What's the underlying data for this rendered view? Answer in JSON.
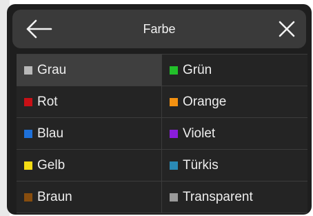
{
  "dialog": {
    "title": "Farbe"
  },
  "colors": [
    {
      "label": "Grau",
      "hex": "#b8b8b8",
      "selected": true
    },
    {
      "label": "Grün",
      "hex": "#22c02a",
      "selected": false
    },
    {
      "label": "Rot",
      "hex": "#c81016",
      "selected": false
    },
    {
      "label": "Orange",
      "hex": "#f39111",
      "selected": false
    },
    {
      "label": "Blau",
      "hex": "#1e70d8",
      "selected": false
    },
    {
      "label": "Violet",
      "hex": "#8a1ddc",
      "selected": false
    },
    {
      "label": "Gelb",
      "hex": "#f4dc14",
      "selected": false
    },
    {
      "label": "Türkis",
      "hex": "#2a8ab6",
      "selected": false
    },
    {
      "label": "Braun",
      "hex": "#874d0e",
      "selected": false
    },
    {
      "label": "Transparent",
      "hex": "#9a9a9a",
      "selected": false
    }
  ],
  "theme": {
    "panel_bg": "#1e1e1e",
    "header_bg": "#3a3a3a",
    "selected_row_bg": "#3f3f3f"
  }
}
